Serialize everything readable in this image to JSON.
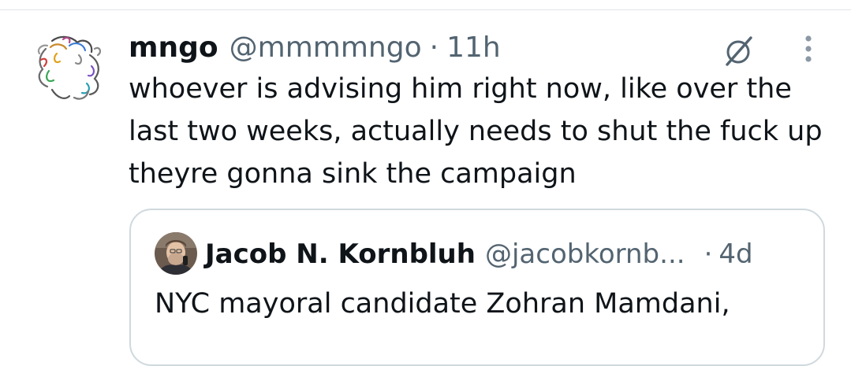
{
  "tweet": {
    "display_name": "mngo",
    "handle": "@mmmmngo",
    "separator": "·",
    "time": "11h",
    "text": "whoever is advising him right now, like over the last two weeks, actually needs to shut the fuck up theyre gonna sink the campaign",
    "avatar_icon": "scribble-avatar",
    "actions": {
      "grok_icon": "grok-icon",
      "more_icon": "more-vertical-icon"
    }
  },
  "quote": {
    "display_name": "Jacob N. Kornbluh",
    "handle": "@jacobkornb...",
    "separator": "·",
    "time": "4d",
    "text": "NYC mayoral candidate Zohran Mamdani,",
    "avatar_icon": "profile-photo"
  },
  "colors": {
    "text_primary": "#0f1419",
    "text_secondary": "#536471",
    "border": "#cfd9de",
    "divider": "#e1e5e9"
  }
}
